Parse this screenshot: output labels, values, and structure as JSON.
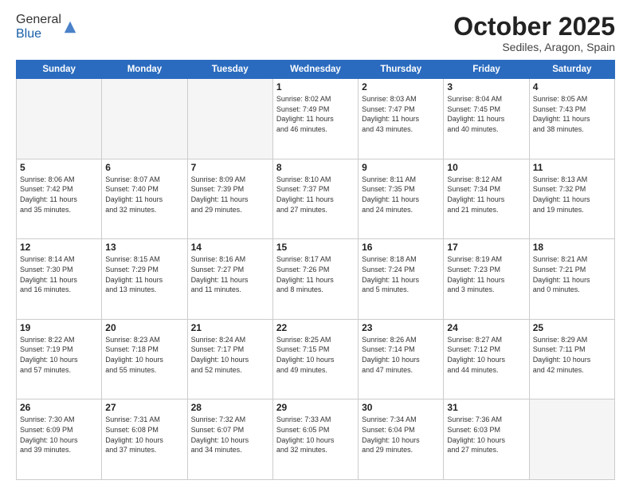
{
  "logo": {
    "general": "General",
    "blue": "Blue"
  },
  "header": {
    "month": "October 2025",
    "location": "Sediles, Aragon, Spain"
  },
  "weekdays": [
    "Sunday",
    "Monday",
    "Tuesday",
    "Wednesday",
    "Thursday",
    "Friday",
    "Saturday"
  ],
  "weeks": [
    [
      {
        "day": "",
        "info": ""
      },
      {
        "day": "",
        "info": ""
      },
      {
        "day": "",
        "info": ""
      },
      {
        "day": "1",
        "info": "Sunrise: 8:02 AM\nSunset: 7:49 PM\nDaylight: 11 hours\nand 46 minutes."
      },
      {
        "day": "2",
        "info": "Sunrise: 8:03 AM\nSunset: 7:47 PM\nDaylight: 11 hours\nand 43 minutes."
      },
      {
        "day": "3",
        "info": "Sunrise: 8:04 AM\nSunset: 7:45 PM\nDaylight: 11 hours\nand 40 minutes."
      },
      {
        "day": "4",
        "info": "Sunrise: 8:05 AM\nSunset: 7:43 PM\nDaylight: 11 hours\nand 38 minutes."
      }
    ],
    [
      {
        "day": "5",
        "info": "Sunrise: 8:06 AM\nSunset: 7:42 PM\nDaylight: 11 hours\nand 35 minutes."
      },
      {
        "day": "6",
        "info": "Sunrise: 8:07 AM\nSunset: 7:40 PM\nDaylight: 11 hours\nand 32 minutes."
      },
      {
        "day": "7",
        "info": "Sunrise: 8:09 AM\nSunset: 7:39 PM\nDaylight: 11 hours\nand 29 minutes."
      },
      {
        "day": "8",
        "info": "Sunrise: 8:10 AM\nSunset: 7:37 PM\nDaylight: 11 hours\nand 27 minutes."
      },
      {
        "day": "9",
        "info": "Sunrise: 8:11 AM\nSunset: 7:35 PM\nDaylight: 11 hours\nand 24 minutes."
      },
      {
        "day": "10",
        "info": "Sunrise: 8:12 AM\nSunset: 7:34 PM\nDaylight: 11 hours\nand 21 minutes."
      },
      {
        "day": "11",
        "info": "Sunrise: 8:13 AM\nSunset: 7:32 PM\nDaylight: 11 hours\nand 19 minutes."
      }
    ],
    [
      {
        "day": "12",
        "info": "Sunrise: 8:14 AM\nSunset: 7:30 PM\nDaylight: 11 hours\nand 16 minutes."
      },
      {
        "day": "13",
        "info": "Sunrise: 8:15 AM\nSunset: 7:29 PM\nDaylight: 11 hours\nand 13 minutes."
      },
      {
        "day": "14",
        "info": "Sunrise: 8:16 AM\nSunset: 7:27 PM\nDaylight: 11 hours\nand 11 minutes."
      },
      {
        "day": "15",
        "info": "Sunrise: 8:17 AM\nSunset: 7:26 PM\nDaylight: 11 hours\nand 8 minutes."
      },
      {
        "day": "16",
        "info": "Sunrise: 8:18 AM\nSunset: 7:24 PM\nDaylight: 11 hours\nand 5 minutes."
      },
      {
        "day": "17",
        "info": "Sunrise: 8:19 AM\nSunset: 7:23 PM\nDaylight: 11 hours\nand 3 minutes."
      },
      {
        "day": "18",
        "info": "Sunrise: 8:21 AM\nSunset: 7:21 PM\nDaylight: 11 hours\nand 0 minutes."
      }
    ],
    [
      {
        "day": "19",
        "info": "Sunrise: 8:22 AM\nSunset: 7:19 PM\nDaylight: 10 hours\nand 57 minutes."
      },
      {
        "day": "20",
        "info": "Sunrise: 8:23 AM\nSunset: 7:18 PM\nDaylight: 10 hours\nand 55 minutes."
      },
      {
        "day": "21",
        "info": "Sunrise: 8:24 AM\nSunset: 7:17 PM\nDaylight: 10 hours\nand 52 minutes."
      },
      {
        "day": "22",
        "info": "Sunrise: 8:25 AM\nSunset: 7:15 PM\nDaylight: 10 hours\nand 49 minutes."
      },
      {
        "day": "23",
        "info": "Sunrise: 8:26 AM\nSunset: 7:14 PM\nDaylight: 10 hours\nand 47 minutes."
      },
      {
        "day": "24",
        "info": "Sunrise: 8:27 AM\nSunset: 7:12 PM\nDaylight: 10 hours\nand 44 minutes."
      },
      {
        "day": "25",
        "info": "Sunrise: 8:29 AM\nSunset: 7:11 PM\nDaylight: 10 hours\nand 42 minutes."
      }
    ],
    [
      {
        "day": "26",
        "info": "Sunrise: 7:30 AM\nSunset: 6:09 PM\nDaylight: 10 hours\nand 39 minutes."
      },
      {
        "day": "27",
        "info": "Sunrise: 7:31 AM\nSunset: 6:08 PM\nDaylight: 10 hours\nand 37 minutes."
      },
      {
        "day": "28",
        "info": "Sunrise: 7:32 AM\nSunset: 6:07 PM\nDaylight: 10 hours\nand 34 minutes."
      },
      {
        "day": "29",
        "info": "Sunrise: 7:33 AM\nSunset: 6:05 PM\nDaylight: 10 hours\nand 32 minutes."
      },
      {
        "day": "30",
        "info": "Sunrise: 7:34 AM\nSunset: 6:04 PM\nDaylight: 10 hours\nand 29 minutes."
      },
      {
        "day": "31",
        "info": "Sunrise: 7:36 AM\nSunset: 6:03 PM\nDaylight: 10 hours\nand 27 minutes."
      },
      {
        "day": "",
        "info": ""
      }
    ]
  ]
}
